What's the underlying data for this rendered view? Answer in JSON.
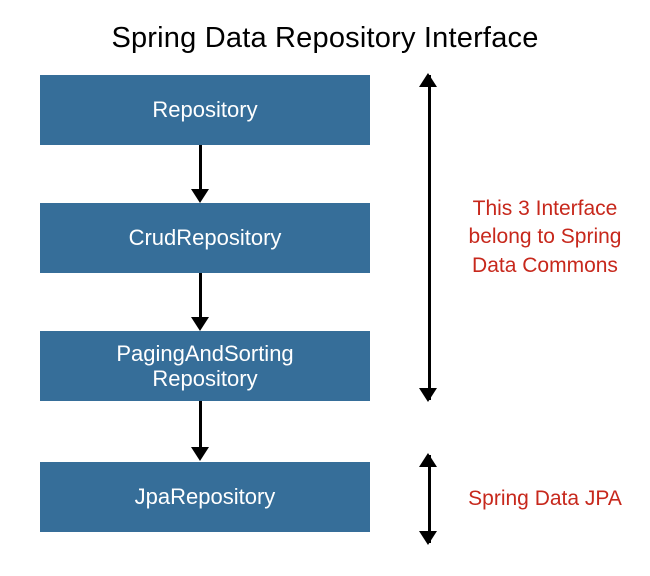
{
  "title": "Spring Data Repository Interface",
  "boxes": {
    "b1": "Repository",
    "b2": "CrudRepository",
    "b3_line1": "PagingAndSorting",
    "b3_line2": "Repository",
    "b4": "JpaRepository"
  },
  "annotations": {
    "a1_line1": "This 3 Interface",
    "a1_line2": "belong to Spring",
    "a1_line3": "Data Commons",
    "a2": "Spring Data JPA"
  },
  "colors": {
    "box_bg": "#366e99",
    "annot": "#c7281c"
  }
}
